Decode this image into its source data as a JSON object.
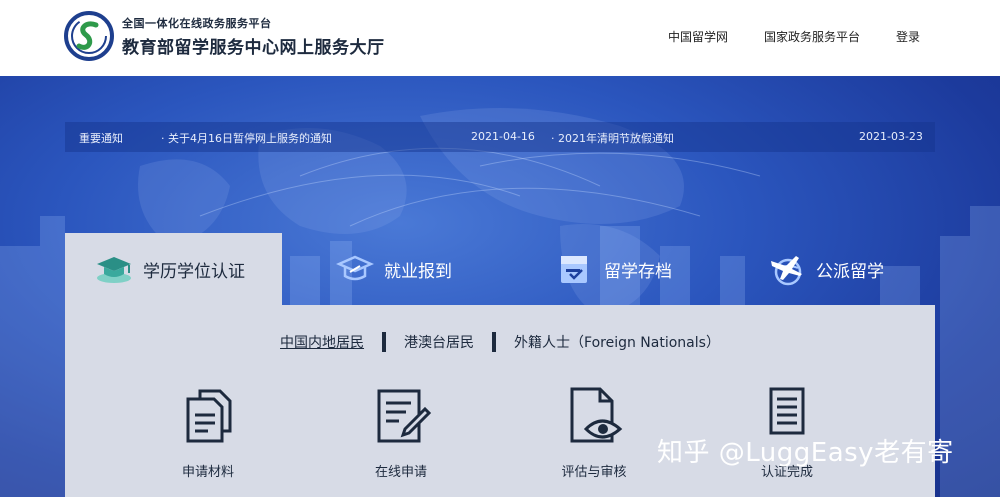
{
  "header": {
    "subtitle": "全国一体化在线政务服务平台",
    "title": "教育部留学服务中心网上服务大厅",
    "nav": [
      "中国留学网",
      "国家政务服务平台",
      "登录"
    ]
  },
  "notice": {
    "label": "重要通知",
    "items": [
      {
        "text": "· 关于4月16日暂停网上服务的通知",
        "date": "2021-04-16"
      },
      {
        "text": "· 2021年清明节放假通知",
        "date": "2021-03-23"
      }
    ]
  },
  "tabs": [
    {
      "label": "学历学位认证",
      "icon": "graduation-cap-icon",
      "active": true
    },
    {
      "label": "就业报到",
      "icon": "diploma-cap-icon",
      "active": false
    },
    {
      "label": "留学存档",
      "icon": "archive-folder-icon",
      "active": false
    },
    {
      "label": "公派留学",
      "icon": "airplane-globe-icon",
      "active": false
    }
  ],
  "subtabs": [
    {
      "label": "中国内地居民",
      "active": true
    },
    {
      "label": "港澳台居民",
      "active": false
    },
    {
      "label": "外籍人士（Foreign Nationals）",
      "active": false
    }
  ],
  "steps": [
    {
      "label": "申请材料",
      "icon": "documents-icon"
    },
    {
      "label": "在线申请",
      "icon": "edit-form-icon"
    },
    {
      "label": "评估与审核",
      "icon": "document-eye-icon"
    },
    {
      "label": "认证完成",
      "icon": "certificate-icon"
    }
  ],
  "watermark": "知乎 @LuggEasy老有寄",
  "colors": {
    "accent": "#1d2a3e",
    "hero": "#2b56be",
    "panel": "#d7dbe6"
  }
}
